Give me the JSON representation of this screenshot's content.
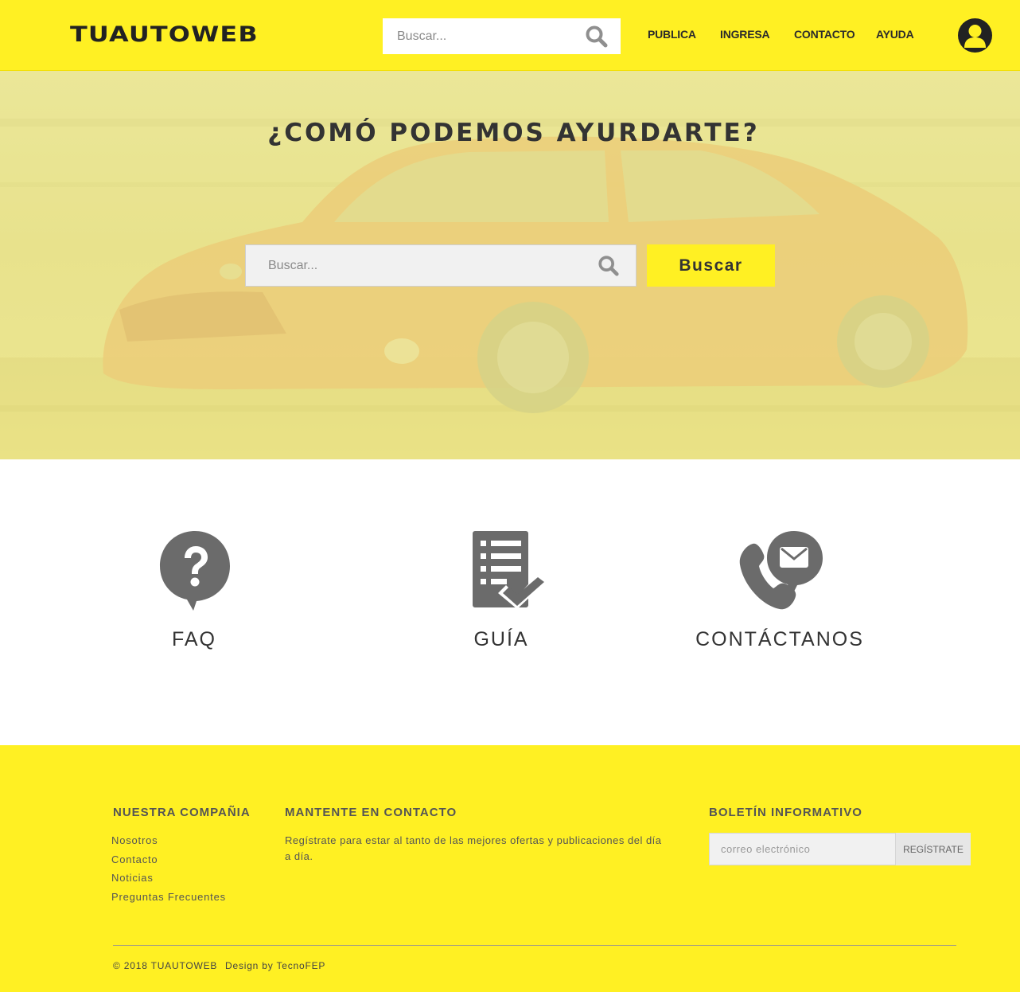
{
  "header": {
    "logo": "TUAUTOWEB",
    "search_placeholder": "Buscar...",
    "nav": [
      {
        "label": "PUBLICA"
      },
      {
        "label": "INGRESA"
      },
      {
        "label": "CONTACTO"
      },
      {
        "label": "AYUDA"
      }
    ]
  },
  "hero": {
    "title": "¿COMÓ PODEMOS AYURDARTE?",
    "search_placeholder": "Buscar...",
    "button_label": "Buscar"
  },
  "features": [
    {
      "label": "FAQ",
      "icon": "question-bubble-icon"
    },
    {
      "label": "GUÍA",
      "icon": "checklist-icon"
    },
    {
      "label": "CONTÁCTANOS",
      "icon": "phone-mail-icon"
    }
  ],
  "footer": {
    "company": {
      "heading": "NUESTRA COMPAÑIA",
      "links": [
        "Nosotros",
        "Contacto",
        "Noticias",
        "Preguntas Frecuentes"
      ]
    },
    "contact": {
      "heading": "MANTENTE EN CONTACTO",
      "text": "Regístrate para estar al tanto de las mejores ofertas y publicaciones del día a día."
    },
    "newsletter": {
      "heading": "BOLETÍN INFORMATIVO",
      "placeholder": "correo electrónico",
      "button_label": "REGÍSTRATE"
    },
    "copyright": "© 2018 TUAUTOWEB",
    "credit": "Design by TecnoFEP"
  },
  "colors": {
    "brand_yellow": "#fff023",
    "text_dark": "#333333",
    "icon_gray": "#6b6b6b"
  }
}
